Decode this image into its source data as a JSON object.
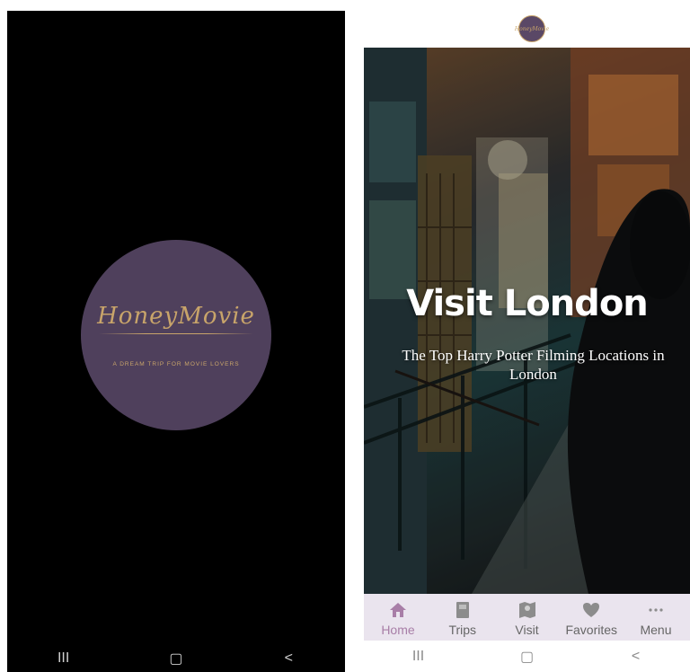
{
  "splash": {
    "logo_text": "HoneyMovie",
    "tagline": "A DREAM TRIP FOR MOVIE LOVERS",
    "circle_color": "#4f405c",
    "gold_color": "#c8a46a"
  },
  "system_nav": {
    "recents": "III",
    "home": "▢",
    "back": "<"
  },
  "app": {
    "top_logo_text": "HoneyMovie",
    "hero": {
      "title": "Visit London",
      "subtitle": "The Top Harry Potter Filming Locations in London"
    },
    "tabs": [
      {
        "label": "Home",
        "icon": "home-icon",
        "active": true
      },
      {
        "label": "Trips",
        "icon": "book-icon",
        "active": false
      },
      {
        "label": "Visit",
        "icon": "map-icon",
        "active": false
      },
      {
        "label": "Favorites",
        "icon": "heart-icon",
        "active": false
      },
      {
        "label": "Menu",
        "icon": "more-icon",
        "active": false
      }
    ],
    "accent_color": "#a87ea7",
    "tabbar_color": "#eae4ee"
  }
}
